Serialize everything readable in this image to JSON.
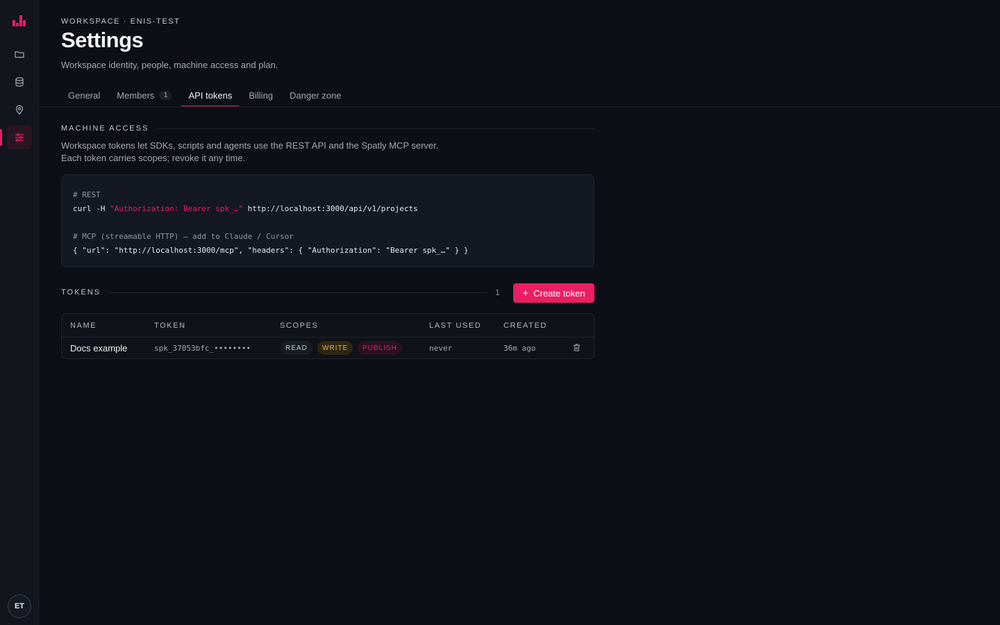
{
  "sidebar": {
    "logo_icon": "bar-chart-logo-icon",
    "items": [
      {
        "icon": "folder-icon",
        "name": "projects"
      },
      {
        "icon": "database-icon",
        "name": "datasets"
      },
      {
        "icon": "map-pin-icon",
        "name": "places"
      },
      {
        "icon": "sliders-icon",
        "name": "settings",
        "active": true
      }
    ],
    "avatar": "ET"
  },
  "header": {
    "eyebrow": "WORKSPACE · ENIS-TEST",
    "title": "Settings",
    "subtitle": "Workspace identity, people, machine access and plan."
  },
  "tabs": [
    {
      "label": "General"
    },
    {
      "label": "Members",
      "count": "1"
    },
    {
      "label": "API tokens",
      "active": true
    },
    {
      "label": "Billing"
    },
    {
      "label": "Danger zone"
    }
  ],
  "machine_access": {
    "heading": "MACHINE ACCESS",
    "desc_line1": "Workspace tokens let SDKs, scripts and agents use the REST API and the Spatly MCP server.",
    "desc_line2": "Each token carries scopes; revoke it any time.",
    "code": {
      "rest_comment": "# REST",
      "rest_cmd_prefix": "curl -H ",
      "rest_cmd_header": "\"Authorization: Bearer spk_…\"",
      "rest_cmd_url": " http://localhost:3000/api/v1/projects",
      "mcp_comment": "# MCP (streamable HTTP) — add to Claude / Cursor",
      "mcp_json": "{ \"url\": \"http://localhost:3000/mcp\", \"headers\": { \"Authorization\": \"Bearer spk_…\" } }"
    }
  },
  "tokens": {
    "heading": "TOKENS",
    "count": "1",
    "create_label": "Create token",
    "columns": [
      "NAME",
      "TOKEN",
      "SCOPES",
      "LAST USED",
      "CREATED"
    ],
    "rows": [
      {
        "name": "Docs example",
        "token": "spk_37053bfc_••••••••",
        "scopes": [
          "READ",
          "WRITE",
          "PUBLISH"
        ],
        "last_used": "never",
        "created": "36m ago"
      }
    ]
  },
  "colors": {
    "accent": "#e91e63",
    "write_scope": "#f1b62a",
    "background": "#0c0f15"
  }
}
